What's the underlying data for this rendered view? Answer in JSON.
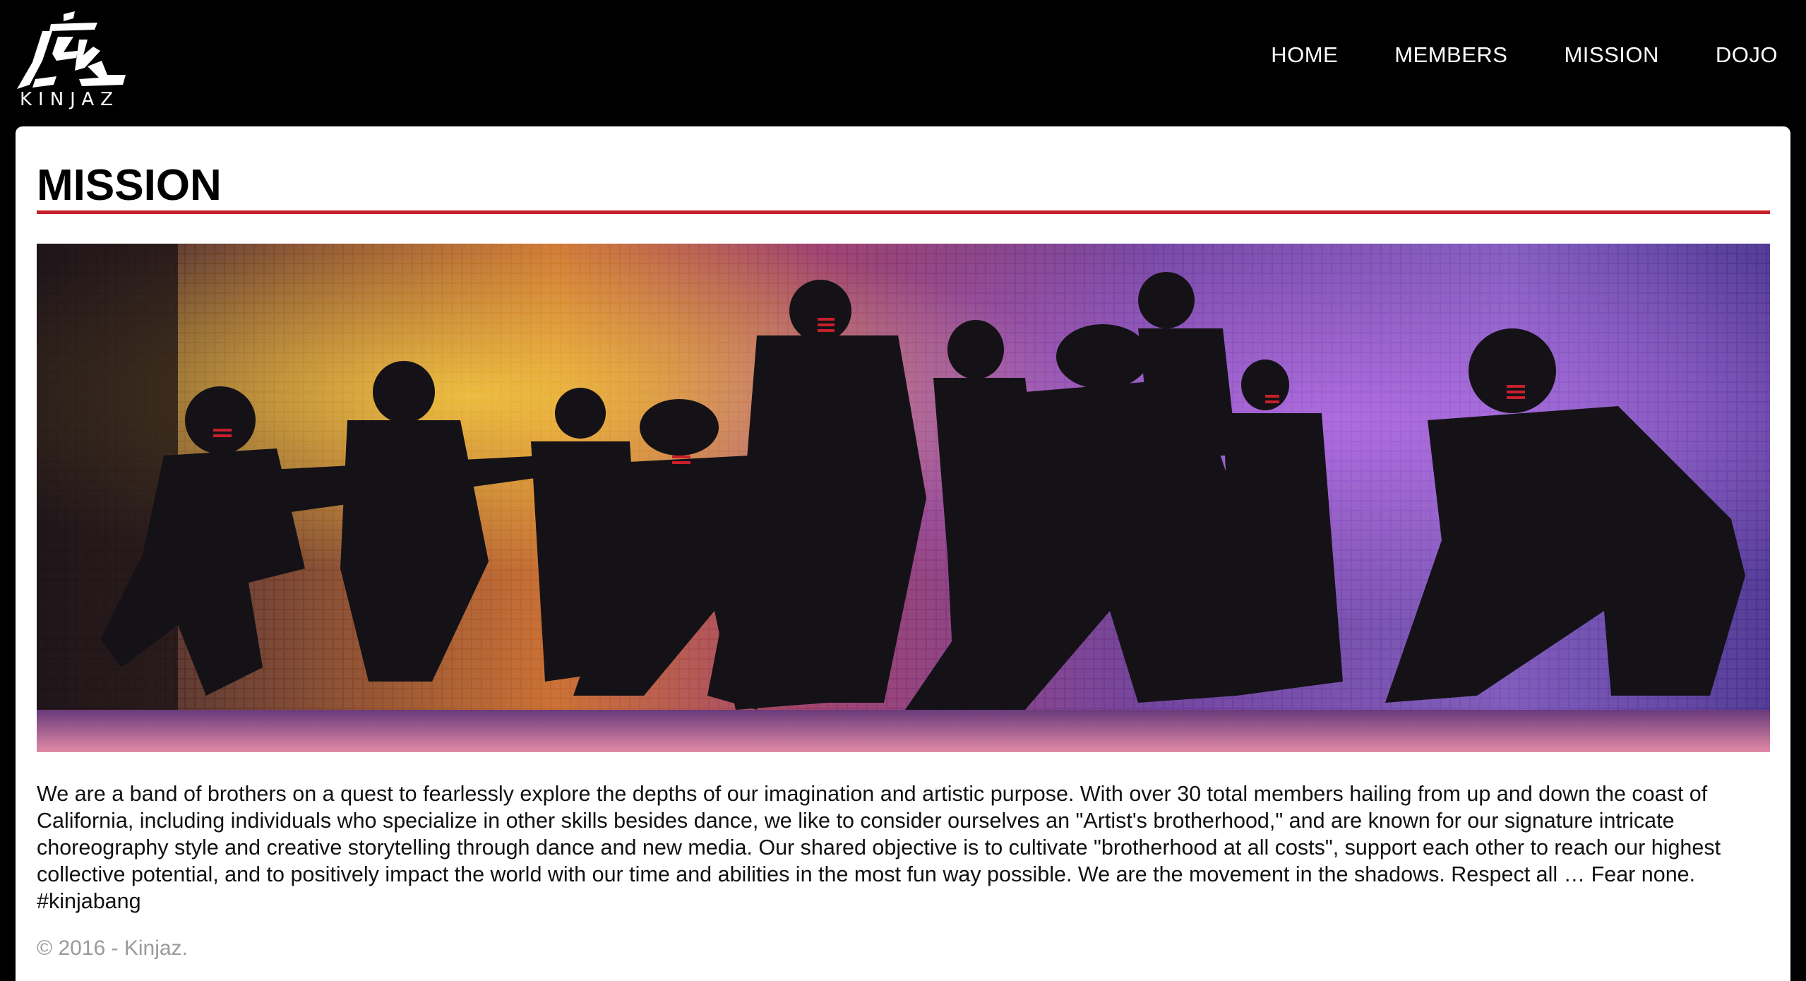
{
  "header": {
    "logo_text": "KINJAZ",
    "nav": [
      {
        "label": "HOME"
      },
      {
        "label": "MEMBERS"
      },
      {
        "label": "MISSION"
      },
      {
        "label": "DOJO"
      }
    ]
  },
  "main": {
    "title": "MISSION",
    "accent_color": "#c8202b",
    "body": "We are a band of brothers on a quest to fearlessly explore the depths of our imagination and artistic purpose. With over 30 total members hailing from up and down the coast of California, including individuals who specialize in other skills besides dance, we like to consider ourselves an \"Artist's brotherhood,\" and are known for our signature intricate choreography style and creative storytelling through dance and new media. Our shared objective is to cultivate \"brotherhood at all costs\", support each other to reach our highest collective potential, and to positively impact the world with our time and abilities in the most fun way possible. We are the movement in the shadows. Respect all … Fear none. #kinjabang"
  },
  "footer": {
    "copyright": "© 2016 - Kinjaz."
  }
}
